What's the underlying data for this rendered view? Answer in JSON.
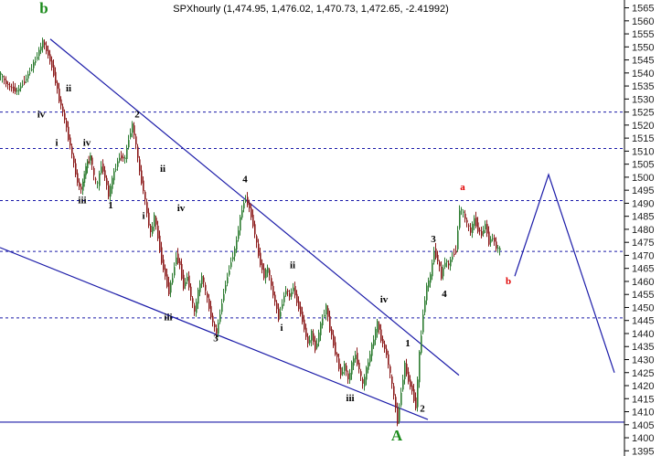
{
  "chart_data": {
    "type": "candlestick",
    "title": "SPXhourly (1,474.95, 1,476.02, 1,470.73, 1,472.65, -2.41992)",
    "ylim": [
      1393,
      1568
    ],
    "yticks": [
      1395,
      1400,
      1405,
      1410,
      1415,
      1420,
      1425,
      1430,
      1435,
      1440,
      1445,
      1450,
      1455,
      1460,
      1465,
      1470,
      1475,
      1480,
      1485,
      1490,
      1495,
      1500,
      1505,
      1510,
      1515,
      1520,
      1525,
      1530,
      1535,
      1540,
      1545,
      1550,
      1555,
      1560,
      1565
    ],
    "grid": "horizontal-dashed",
    "colors": {
      "up": "#2e7d32",
      "down": "#8b1a1a",
      "line": "#1a1aa8",
      "dashed": "#1a1aa8",
      "green_label": "#1a8a1a",
      "red_label": "#e00000"
    },
    "horizontal_levels": {
      "dashed": [
        1525,
        1511,
        1491,
        1471.5,
        1446
      ],
      "solid": [
        1406
      ]
    },
    "price_path": [
      [
        0,
        1540
      ],
      [
        10,
        1535
      ],
      [
        20,
        1533
      ],
      [
        30,
        1538
      ],
      [
        40,
        1545
      ],
      [
        48,
        1552
      ],
      [
        54,
        1547
      ],
      [
        60,
        1540
      ],
      [
        66,
        1530
      ],
      [
        72,
        1522
      ],
      [
        78,
        1512
      ],
      [
        82,
        1505
      ],
      [
        86,
        1498
      ],
      [
        90,
        1495
      ],
      [
        95,
        1504
      ],
      [
        100,
        1508
      ],
      [
        104,
        1500
      ],
      [
        108,
        1497
      ],
      [
        112,
        1505
      ],
      [
        116,
        1500
      ],
      [
        120,
        1493
      ],
      [
        126,
        1502
      ],
      [
        132,
        1508
      ],
      [
        138,
        1507
      ],
      [
        142,
        1515
      ],
      [
        146,
        1520
      ],
      [
        150,
        1512
      ],
      [
        154,
        1502
      ],
      [
        158,
        1495
      ],
      [
        162,
        1486
      ],
      [
        166,
        1478
      ],
      [
        170,
        1485
      ],
      [
        174,
        1477
      ],
      [
        178,
        1468
      ],
      [
        182,
        1462
      ],
      [
        186,
        1456
      ],
      [
        190,
        1462
      ],
      [
        194,
        1470
      ],
      [
        198,
        1466
      ],
      [
        202,
        1458
      ],
      [
        206,
        1462
      ],
      [
        210,
        1454
      ],
      [
        214,
        1448
      ],
      [
        218,
        1456
      ],
      [
        222,
        1462
      ],
      [
        226,
        1456
      ],
      [
        230,
        1450
      ],
      [
        234,
        1444
      ],
      [
        238,
        1440
      ],
      [
        242,
        1448
      ],
      [
        246,
        1456
      ],
      [
        250,
        1462
      ],
      [
        254,
        1468
      ],
      [
        258,
        1472
      ],
      [
        262,
        1480
      ],
      [
        266,
        1488
      ],
      [
        270,
        1492
      ],
      [
        274,
        1488
      ],
      [
        278,
        1482
      ],
      [
        282,
        1474
      ],
      [
        286,
        1467
      ],
      [
        290,
        1462
      ],
      [
        294,
        1465
      ],
      [
        298,
        1458
      ],
      [
        302,
        1452
      ],
      [
        306,
        1446
      ],
      [
        310,
        1452
      ],
      [
        314,
        1457
      ],
      [
        318,
        1454
      ],
      [
        322,
        1458
      ],
      [
        326,
        1452
      ],
      [
        330,
        1448
      ],
      [
        334,
        1442
      ],
      [
        338,
        1436
      ],
      [
        342,
        1440
      ],
      [
        346,
        1434
      ],
      [
        350,
        1440
      ],
      [
        354,
        1446
      ],
      [
        358,
        1450
      ],
      [
        362,
        1442
      ],
      [
        366,
        1436
      ],
      [
        370,
        1430
      ],
      [
        374,
        1424
      ],
      [
        378,
        1428
      ],
      [
        382,
        1422
      ],
      [
        386,
        1428
      ],
      [
        390,
        1432
      ],
      [
        394,
        1426
      ],
      [
        398,
        1420
      ],
      [
        402,
        1426
      ],
      [
        406,
        1432
      ],
      [
        410,
        1438
      ],
      [
        414,
        1444
      ],
      [
        418,
        1438
      ],
      [
        424,
        1432
      ],
      [
        428,
        1424
      ],
      [
        432,
        1416
      ],
      [
        436,
        1406
      ],
      [
        440,
        1418
      ],
      [
        444,
        1428
      ],
      [
        448,
        1422
      ],
      [
        452,
        1418
      ],
      [
        456,
        1412
      ],
      [
        460,
        1432
      ],
      [
        464,
        1448
      ],
      [
        468,
        1458
      ],
      [
        472,
        1462
      ],
      [
        476,
        1472
      ],
      [
        480,
        1468
      ],
      [
        484,
        1462
      ],
      [
        488,
        1468
      ],
      [
        492,
        1466
      ],
      [
        496,
        1470
      ],
      [
        500,
        1472
      ],
      [
        504,
        1488
      ],
      [
        508,
        1486
      ],
      [
        512,
        1482
      ],
      [
        516,
        1479
      ],
      [
        520,
        1484
      ],
      [
        524,
        1480
      ],
      [
        528,
        1478
      ],
      [
        532,
        1482
      ],
      [
        536,
        1475
      ],
      [
        540,
        1477
      ],
      [
        544,
        1473
      ],
      [
        548,
        1472
      ]
    ],
    "annotations": [
      {
        "text": "b",
        "color": "green",
        "x": 48,
        "y": 1563
      },
      {
        "text": "ii",
        "color": "black",
        "x": 75,
        "y": 1533
      },
      {
        "text": "iv",
        "color": "black",
        "x": 45,
        "y": 1523
      },
      {
        "text": "i",
        "color": "black",
        "x": 62,
        "y": 1512
      },
      {
        "text": "iv",
        "color": "black",
        "x": 95,
        "y": 1512
      },
      {
        "text": "2",
        "color": "black",
        "x": 150,
        "y": 1523
      },
      {
        "text": "ii",
        "color": "black",
        "x": 178,
        "y": 1502
      },
      {
        "text": "iii",
        "color": "black",
        "x": 90,
        "y": 1490
      },
      {
        "text": "1",
        "color": "black",
        "x": 121,
        "y": 1488
      },
      {
        "text": "iv",
        "color": "black",
        "x": 198,
        "y": 1487
      },
      {
        "text": "i",
        "color": "black",
        "x": 157,
        "y": 1484
      },
      {
        "text": "4",
        "color": "black",
        "x": 268,
        "y": 1498
      },
      {
        "text": "ii",
        "color": "black",
        "x": 320,
        "y": 1465
      },
      {
        "text": "iii",
        "color": "black",
        "x": 184,
        "y": 1445
      },
      {
        "text": "i",
        "color": "black",
        "x": 308,
        "y": 1441
      },
      {
        "text": "3",
        "color": "black",
        "x": 236,
        "y": 1437
      },
      {
        "text": "iv",
        "color": "black",
        "x": 420,
        "y": 1452
      },
      {
        "text": "1",
        "color": "black",
        "x": 446,
        "y": 1435
      },
      {
        "text": "iii",
        "color": "black",
        "x": 383,
        "y": 1414
      },
      {
        "text": "2",
        "color": "black",
        "x": 462,
        "y": 1410
      },
      {
        "text": "A",
        "color": "green",
        "x": 434,
        "y": 1399
      },
      {
        "text": "3",
        "color": "black",
        "x": 474,
        "y": 1475
      },
      {
        "text": "4",
        "color": "black",
        "x": 486,
        "y": 1454
      },
      {
        "text": "a",
        "color": "red",
        "x": 506,
        "y": 1495
      },
      {
        "text": "b",
        "color": "red",
        "x": 556,
        "y": 1459
      }
    ],
    "trend_lines": [
      {
        "name": "upper",
        "from": [
          55,
          1553
        ],
        "to": [
          502,
          1424
        ]
      },
      {
        "name": "lower",
        "from": [
          0,
          1473
        ],
        "to": [
          468,
          1407
        ]
      },
      {
        "name": "projection",
        "from": [
          563,
          1462
        ],
        "via": [
          600,
          1501
        ],
        "to": [
          672,
          1425
        ]
      }
    ]
  }
}
